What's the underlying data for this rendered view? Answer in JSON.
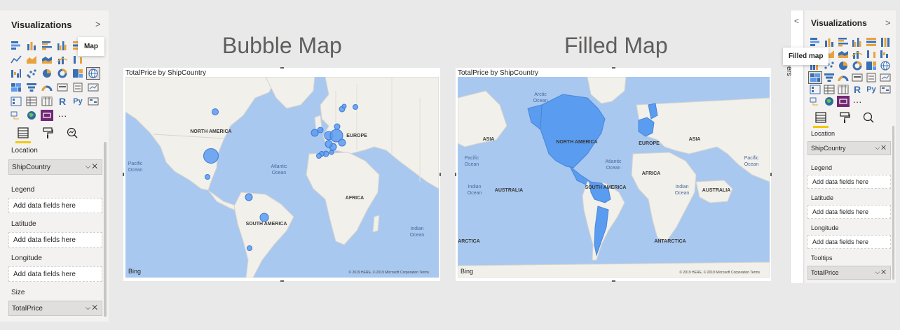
{
  "left_pane": {
    "title": "Visualizations",
    "collapse": ">",
    "tooltip": "Map",
    "more": "···",
    "python_label": "Py",
    "r_label": "R",
    "wells": {
      "location": "Location",
      "location_value": "ShipCountry",
      "legend": "Legend",
      "latitude": "Latitude",
      "longitude": "Longitude",
      "size": "Size",
      "size_value": "TotalPrice",
      "placeholder": "Add data fields here"
    }
  },
  "headings": {
    "bubble": "Bubble Map",
    "filled": "Filled Map"
  },
  "bubble_visual": {
    "title": "TotalPrice by ShipCountry",
    "labels": {
      "north_america": "NORTH AMERICA",
      "europe": "EUROPE",
      "africa": "AFRICA",
      "south_america": "SOUTH AMERICA",
      "atlantic": "Atlantic",
      "ocean": "Ocean",
      "pacific": "Pacific",
      "indian": "Indian"
    }
  },
  "filled_visual": {
    "title": "TotalPrice by ShipCountry",
    "labels": {
      "north_america": "NORTH AMERICA",
      "europe": "EUROPE",
      "africa": "AFRICA",
      "south_america": "SOUTH AMERICA",
      "asia": "ASIA",
      "australia": "AUSTRALIA",
      "antarctica": "ANTARCTICA",
      "arctica": "ARCTICA",
      "arctic": "Arctic",
      "atlantic": "Atlantic",
      "ocean": "Ocean",
      "pacific": "Pacific",
      "indian": "Indian"
    }
  },
  "map_common": {
    "bing": "Bing",
    "copyright": "© 2019 HERE, © 2019 Microsoft Corporation  Terms"
  },
  "right_pane": {
    "title": "Visualizations",
    "back": "<",
    "collapse": ">",
    "tooltip": "Filled map",
    "filters": "ers",
    "more": "···",
    "python_label": "Py",
    "r_label": "R",
    "wells": {
      "location": "Location",
      "location_value": "ShipCountry",
      "legend": "Legend",
      "latitude": "Latitude",
      "longitude": "Longitude",
      "tooltips": "Tooltips",
      "tooltips_value": "TotalPrice",
      "placeholder": "Add data fields here"
    }
  },
  "colors": {
    "ocean": "#a8c8f0",
    "land": "#f2f0ea",
    "bubble": "#5b9bf0",
    "filled": "#5a9cf0",
    "accent": "#f2c811"
  }
}
